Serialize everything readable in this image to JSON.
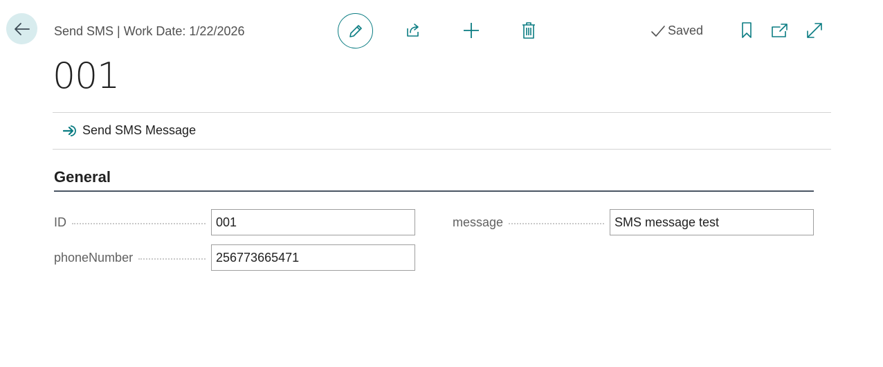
{
  "header": {
    "title": "Send SMS | Work Date: 1/22/2026",
    "status": "Saved"
  },
  "record": {
    "title": "001"
  },
  "actions": {
    "send_sms": "Send SMS Message"
  },
  "section": {
    "title": "General"
  },
  "fields": {
    "id": {
      "label": "ID",
      "value": "001"
    },
    "phone": {
      "label": "phoneNumber",
      "value": "256773665471"
    },
    "message": {
      "label": "message",
      "value": "SMS message test"
    }
  },
  "icons": {
    "back": "back-arrow-icon",
    "edit": "pencil-icon",
    "share": "share-icon",
    "new": "plus-icon",
    "delete": "trash-icon",
    "saved": "checkmark-icon",
    "bookmark": "bookmark-icon",
    "popout": "open-new-window-icon",
    "expand": "expand-icon",
    "send": "send-arrow-icon"
  },
  "colors": {
    "accent": "#0a7c82",
    "back_button_bg": "#d8ecee",
    "section_line": "#4a5563"
  }
}
